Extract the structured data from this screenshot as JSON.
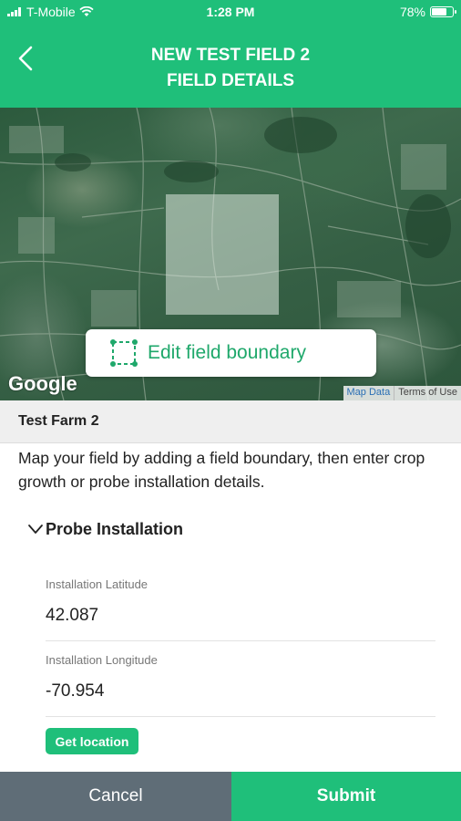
{
  "status_bar": {
    "carrier": "T-Mobile",
    "time": "1:28 PM",
    "battery": "78%",
    "battery_level": 0.78
  },
  "header": {
    "title_line1": "NEW TEST FIELD 2",
    "title_line2": "FIELD DETAILS",
    "back_icon": "chevron-left-icon"
  },
  "map": {
    "logo": "Google",
    "map_data_link": "Map Data",
    "terms_link": "Terms of Use",
    "edit_boundary_label": "Edit field boundary",
    "edit_boundary_icon": "boundary-select-icon"
  },
  "farm": {
    "name": "Test Farm 2"
  },
  "intro_text": "Map your field by adding a field boundary, then enter crop growth or probe installation details.",
  "probe_section": {
    "title": "Probe Installation",
    "latitude_label": "Installation Latitude",
    "latitude_value": "42.087",
    "longitude_label": "Installation Longitude",
    "longitude_value": "-70.954",
    "get_location_label": "Get location"
  },
  "footer": {
    "cancel_label": "Cancel",
    "submit_label": "Submit"
  },
  "colors": {
    "primary_green": "#1fbf7a",
    "cancel_gray": "#5f6d77"
  }
}
